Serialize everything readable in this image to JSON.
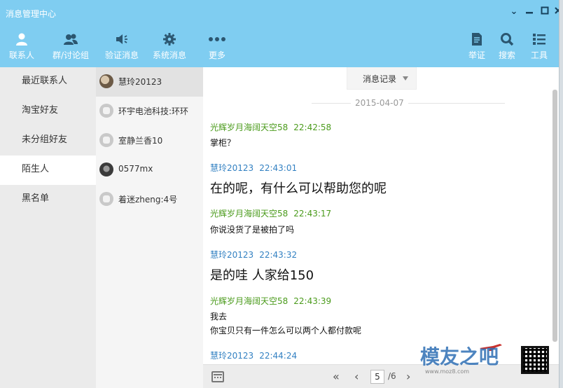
{
  "window": {
    "title": "消息管理中心",
    "controls": [
      "chevron-down-icon",
      "minimize-icon",
      "maximize-icon",
      "close-icon"
    ]
  },
  "toolbar": {
    "left": [
      {
        "label": "联系人",
        "icon": "person-icon",
        "active": true
      },
      {
        "label": "群/讨论组",
        "icon": "group-icon"
      },
      {
        "label": "验证消息",
        "icon": "speaker-icon"
      },
      {
        "label": "系统消息",
        "icon": "gear-icon"
      },
      {
        "label": "更多",
        "icon": "more-icon"
      }
    ],
    "right": [
      {
        "label": "举证",
        "icon": "document-icon"
      },
      {
        "label": "搜索",
        "icon": "search-icon"
      },
      {
        "label": "工具",
        "icon": "tools-list-icon"
      }
    ]
  },
  "categories": [
    {
      "label": "最近联系人"
    },
    {
      "label": "淘宝好友"
    },
    {
      "label": "未分组好友"
    },
    {
      "label": "陌生人",
      "selected": true
    },
    {
      "label": "黑名单"
    }
  ],
  "contacts": [
    {
      "name": "慧玲20123",
      "avatar": "photo",
      "selected": true
    },
    {
      "name": "环宇电池科技:环环",
      "avatar": "default"
    },
    {
      "name": "室静兰香10",
      "avatar": "default"
    },
    {
      "name": "0577mx",
      "avatar": "dark"
    },
    {
      "name": "着迷zheng:4号",
      "avatar": "default"
    }
  ],
  "record_dropdown": {
    "label": "消息记录"
  },
  "date_separator": "2015-04-07",
  "messages": [
    {
      "sender": "光辉岁月海阔天空58",
      "time": "22:42:58",
      "side": "green",
      "lines": [
        "掌柜？"
      ],
      "size": "small"
    },
    {
      "sender": "慧玲20123",
      "time": "22:43:01",
      "side": "blue",
      "lines": [
        "在的呢，有什么可以帮助您的呢"
      ],
      "size": "big"
    },
    {
      "sender": "光辉岁月海阔天空58",
      "time": "22:43:17",
      "side": "green",
      "lines": [
        "你说没货了是被拍了吗"
      ],
      "size": "small"
    },
    {
      "sender": "慧玲20123",
      "time": "22:43:32",
      "side": "blue",
      "lines": [
        "是的哇 人家给150"
      ],
      "size": "big"
    },
    {
      "sender": "光辉岁月海阔天空58",
      "time": "22:43:39",
      "side": "green",
      "lines": [
        "我去",
        "你宝贝只有一件怎么可以两个人都付款呢"
      ],
      "size": "small"
    },
    {
      "sender": "慧玲20123",
      "time": "22:44:24",
      "side": "blue",
      "lines": [],
      "size": "small"
    }
  ],
  "pager": {
    "current_page": "5",
    "total": "/6",
    "first": "«",
    "prev": "‹",
    "next": "›",
    "last": "»"
  },
  "watermark": {
    "text": "模友之吧",
    "url": "www.moz8.com"
  }
}
